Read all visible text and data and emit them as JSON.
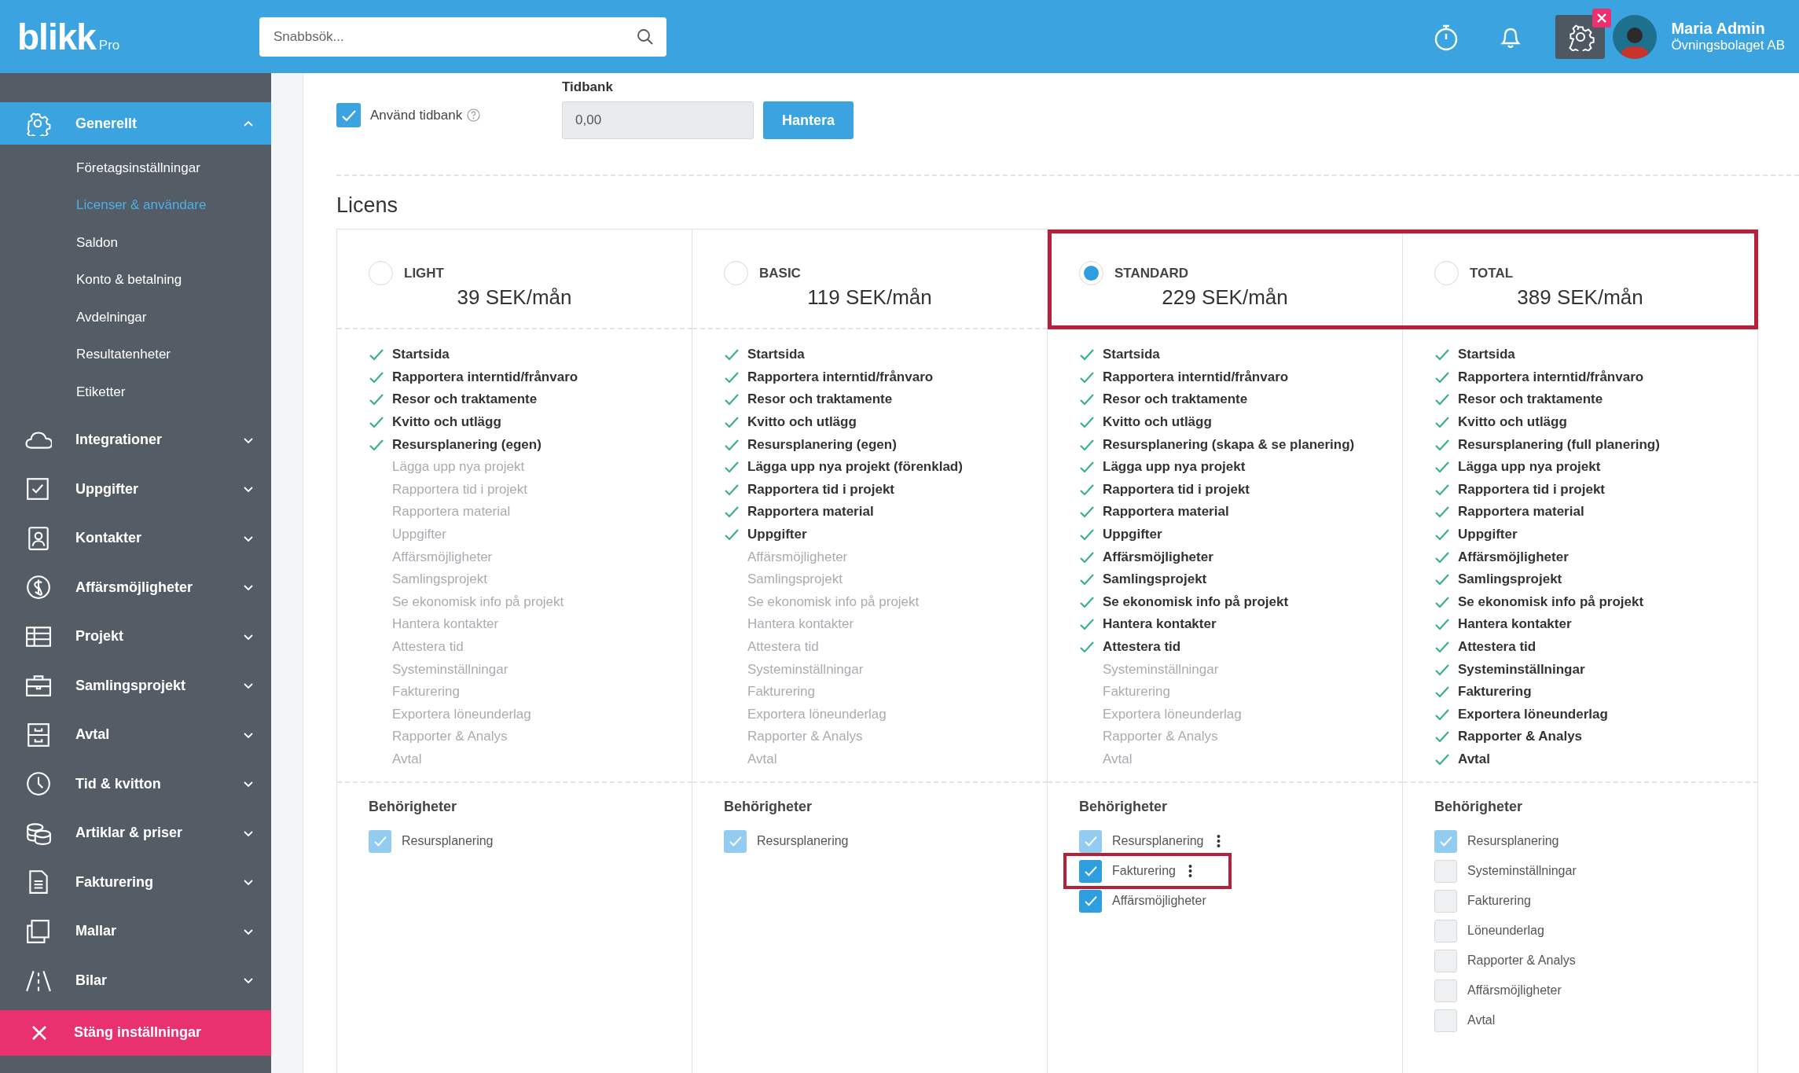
{
  "topbar": {
    "logo": "blikk",
    "logo_suffix": "Pro",
    "search": {
      "placeholder": "Snabbsök..."
    },
    "user": {
      "name": "Maria Admin",
      "company": "Övningsbolaget AB"
    }
  },
  "sidebar": {
    "items": [
      {
        "label": "Generellt",
        "expanded": true,
        "children": [
          {
            "label": "Företagsinställningar",
            "selected": false
          },
          {
            "label": "Licenser & användare",
            "selected": true
          },
          {
            "label": "Saldon",
            "selected": false
          },
          {
            "label": "Konto & betalning",
            "selected": false
          },
          {
            "label": "Avdelningar",
            "selected": false
          },
          {
            "label": "Resultatenheter",
            "selected": false
          },
          {
            "label": "Etiketter",
            "selected": false
          }
        ]
      },
      {
        "label": "Integrationer",
        "expanded": false
      },
      {
        "label": "Uppgifter",
        "expanded": false
      },
      {
        "label": "Kontakter",
        "expanded": false
      },
      {
        "label": "Affärsmöjligheter",
        "expanded": false
      },
      {
        "label": "Projekt",
        "expanded": false
      },
      {
        "label": "Samlingsprojekt",
        "expanded": false
      },
      {
        "label": "Avtal",
        "expanded": false
      },
      {
        "label": "Tid & kvitton",
        "expanded": false
      },
      {
        "label": "Artiklar & priser",
        "expanded": false
      },
      {
        "label": "Fakturering",
        "expanded": false
      },
      {
        "label": "Mallar",
        "expanded": false
      },
      {
        "label": "Bilar",
        "expanded": false
      }
    ],
    "close_button": "Stäng inställningar"
  },
  "timebank": {
    "use_timebank": {
      "label": "Använd tidbank",
      "checked": true
    },
    "field": {
      "label": "Tidbank",
      "value": "0,00"
    },
    "manage_button": "Hantera"
  },
  "license": {
    "title": "Licens",
    "plans": [
      {
        "name": "LIGHT",
        "price": "39 SEK/mån",
        "selected": false,
        "highlighted": false,
        "features": [
          {
            "label": "Startsida",
            "included": true
          },
          {
            "label": "Rapportera interntid/frånvaro",
            "included": true
          },
          {
            "label": "Resor och traktamente",
            "included": true
          },
          {
            "label": "Kvitto och utlägg",
            "included": true
          },
          {
            "label": "Resursplanering (egen)",
            "included": true
          },
          {
            "label": "Lägga upp nya projekt",
            "included": false
          },
          {
            "label": "Rapportera tid i projekt",
            "included": false
          },
          {
            "label": "Rapportera material",
            "included": false
          },
          {
            "label": "Uppgifter",
            "included": false
          },
          {
            "label": "Affärsmöjligheter",
            "included": false
          },
          {
            "label": "Samlingsprojekt",
            "included": false
          },
          {
            "label": "Se ekonomisk info på projekt",
            "included": false
          },
          {
            "label": "Hantera kontakter",
            "included": false
          },
          {
            "label": "Attestera tid",
            "included": false
          },
          {
            "label": "Systeminställningar",
            "included": false
          },
          {
            "label": "Fakturering",
            "included": false
          },
          {
            "label": "Exportera löneunderlag",
            "included": false
          },
          {
            "label": "Rapporter & Analys",
            "included": false
          },
          {
            "label": "Avtal",
            "included": false
          }
        ],
        "permissions_title": "Behörigheter",
        "permissions": [
          {
            "label": "Resursplanering",
            "checked": true,
            "disabled": true,
            "has_menu": false,
            "highlighted": false
          }
        ]
      },
      {
        "name": "BASIC",
        "price": "119 SEK/mån",
        "selected": false,
        "highlighted": false,
        "features": [
          {
            "label": "Startsida",
            "included": true
          },
          {
            "label": "Rapportera interntid/frånvaro",
            "included": true
          },
          {
            "label": "Resor och traktamente",
            "included": true
          },
          {
            "label": "Kvitto och utlägg",
            "included": true
          },
          {
            "label": "Resursplanering (egen)",
            "included": true
          },
          {
            "label": "Lägga upp nya projekt (förenklad)",
            "included": true
          },
          {
            "label": "Rapportera tid i projekt",
            "included": true
          },
          {
            "label": "Rapportera material",
            "included": true
          },
          {
            "label": "Uppgifter",
            "included": true
          },
          {
            "label": "Affärsmöjligheter",
            "included": false
          },
          {
            "label": "Samlingsprojekt",
            "included": false
          },
          {
            "label": "Se ekonomisk info på projekt",
            "included": false
          },
          {
            "label": "Hantera kontakter",
            "included": false
          },
          {
            "label": "Attestera tid",
            "included": false
          },
          {
            "label": "Systeminställningar",
            "included": false
          },
          {
            "label": "Fakturering",
            "included": false
          },
          {
            "label": "Exportera löneunderlag",
            "included": false
          },
          {
            "label": "Rapporter & Analys",
            "included": false
          },
          {
            "label": "Avtal",
            "included": false
          }
        ],
        "permissions_title": "Behörigheter",
        "permissions": [
          {
            "label": "Resursplanering",
            "checked": true,
            "disabled": true,
            "has_menu": false,
            "highlighted": false
          }
        ]
      },
      {
        "name": "STANDARD",
        "price": "229 SEK/mån",
        "selected": true,
        "highlighted": true,
        "features": [
          {
            "label": "Startsida",
            "included": true
          },
          {
            "label": "Rapportera interntid/frånvaro",
            "included": true
          },
          {
            "label": "Resor och traktamente",
            "included": true
          },
          {
            "label": "Kvitto och utlägg",
            "included": true
          },
          {
            "label": "Resursplanering (skapa & se planering)",
            "included": true
          },
          {
            "label": "Lägga upp nya projekt",
            "included": true
          },
          {
            "label": "Rapportera tid i projekt",
            "included": true
          },
          {
            "label": "Rapportera material",
            "included": true
          },
          {
            "label": "Uppgifter",
            "included": true
          },
          {
            "label": "Affärsmöjligheter",
            "included": true
          },
          {
            "label": "Samlingsprojekt",
            "included": true
          },
          {
            "label": "Se ekonomisk info på projekt",
            "included": true
          },
          {
            "label": "Hantera kontakter",
            "included": true
          },
          {
            "label": "Attestera tid",
            "included": true
          },
          {
            "label": "Systeminställningar",
            "included": false
          },
          {
            "label": "Fakturering",
            "included": false
          },
          {
            "label": "Exportera löneunderlag",
            "included": false
          },
          {
            "label": "Rapporter & Analys",
            "included": false
          },
          {
            "label": "Avtal",
            "included": false
          }
        ],
        "permissions_title": "Behörigheter",
        "permissions": [
          {
            "label": "Resursplanering",
            "checked": true,
            "disabled": true,
            "has_menu": true,
            "highlighted": false
          },
          {
            "label": "Fakturering",
            "checked": true,
            "disabled": false,
            "has_menu": true,
            "highlighted": true
          },
          {
            "label": "Affärsmöjligheter",
            "checked": true,
            "disabled": false,
            "has_menu": false,
            "highlighted": false
          }
        ]
      },
      {
        "name": "TOTAL",
        "price": "389 SEK/mån",
        "selected": false,
        "highlighted": true,
        "features": [
          {
            "label": "Startsida",
            "included": true
          },
          {
            "label": "Rapportera interntid/frånvaro",
            "included": true
          },
          {
            "label": "Resor och traktamente",
            "included": true
          },
          {
            "label": "Kvitto och utlägg",
            "included": true
          },
          {
            "label": "Resursplanering (full planering)",
            "included": true
          },
          {
            "label": "Lägga upp nya projekt",
            "included": true
          },
          {
            "label": "Rapportera tid i projekt",
            "included": true
          },
          {
            "label": "Rapportera material",
            "included": true
          },
          {
            "label": "Uppgifter",
            "included": true
          },
          {
            "label": "Affärsmöjligheter",
            "included": true
          },
          {
            "label": "Samlingsprojekt",
            "included": true
          },
          {
            "label": "Se ekonomisk info på projekt",
            "included": true
          },
          {
            "label": "Hantera kontakter",
            "included": true
          },
          {
            "label": "Attestera tid",
            "included": true
          },
          {
            "label": "Systeminställningar",
            "included": true
          },
          {
            "label": "Fakturering",
            "included": true
          },
          {
            "label": "Exportera löneunderlag",
            "included": true
          },
          {
            "label": "Rapporter & Analys",
            "included": true
          },
          {
            "label": "Avtal",
            "included": true
          }
        ],
        "permissions_title": "Behörigheter",
        "permissions": [
          {
            "label": "Resursplanering",
            "checked": true,
            "disabled": true,
            "has_menu": false,
            "highlighted": false
          },
          {
            "label": "Systeminställningar",
            "checked": false,
            "disabled": false,
            "has_menu": false,
            "highlighted": false
          },
          {
            "label": "Fakturering",
            "checked": false,
            "disabled": false,
            "has_menu": false,
            "highlighted": false
          },
          {
            "label": "Löneunderlag",
            "checked": false,
            "disabled": false,
            "has_menu": false,
            "highlighted": false
          },
          {
            "label": "Rapporter & Analys",
            "checked": false,
            "disabled": false,
            "has_menu": false,
            "highlighted": false
          },
          {
            "label": "Affärsmöjligheter",
            "checked": false,
            "disabled": false,
            "has_menu": false,
            "highlighted": false
          },
          {
            "label": "Avtal",
            "checked": false,
            "disabled": false,
            "has_menu": false,
            "highlighted": false
          }
        ]
      }
    ]
  }
}
